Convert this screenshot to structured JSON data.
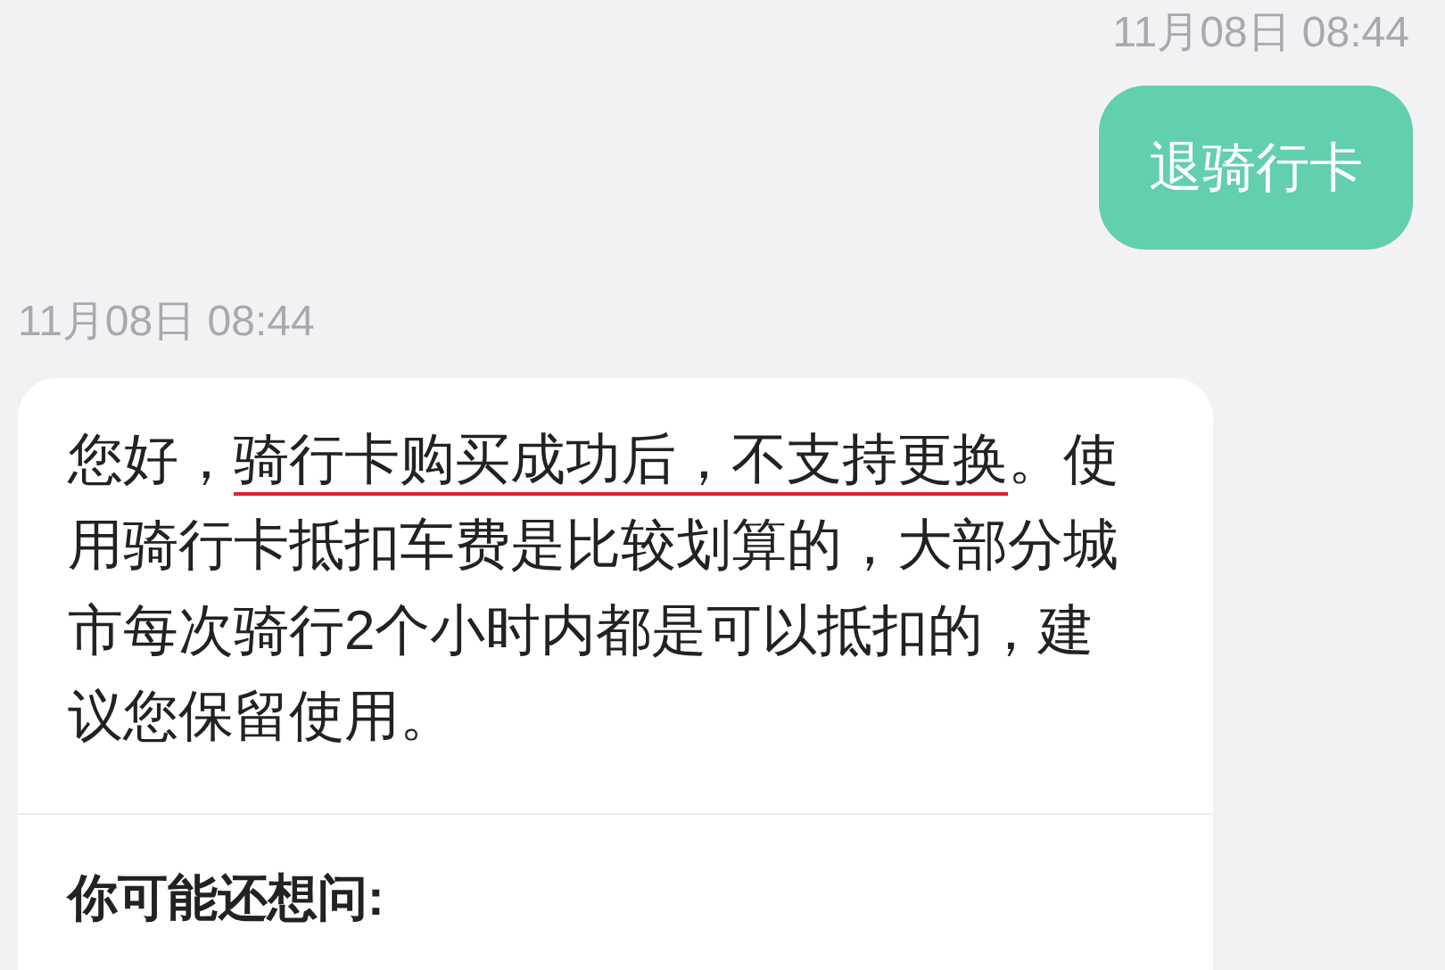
{
  "messages": [
    {
      "kind": "sent_time",
      "text": "11月08日 08:44"
    },
    {
      "kind": "outgoing",
      "text": "退骑行卡"
    },
    {
      "kind": "received_time",
      "text": "11月08日 08:44"
    },
    {
      "kind": "incoming",
      "before": "您好，",
      "highlight": "骑行卡购买成功后，不支持更换",
      "after": "。使用骑行卡抵扣车费是比较划算的，大部分城市每次骑行2个小时内都是可以抵扣的，建议您保留使用。",
      "suggestions_title": "你可能还想问:"
    }
  ]
}
